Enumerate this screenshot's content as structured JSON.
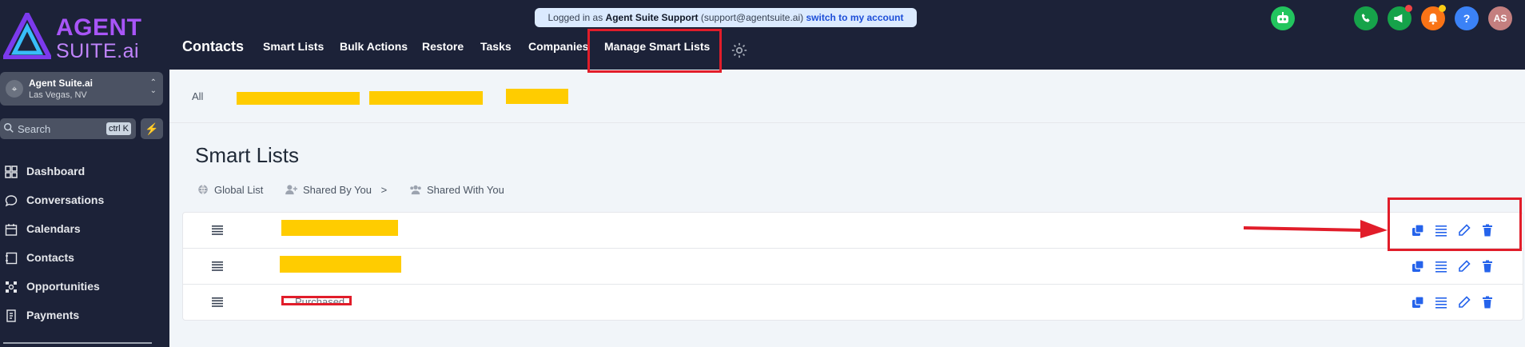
{
  "brand": {
    "line1": "AGENT",
    "line2": "SUITE.ai"
  },
  "login_banner": {
    "prefix": "Logged in as",
    "user": "Agent Suite Support",
    "email": "(support@agentsuite.ai)",
    "switch_label": "switch to my account"
  },
  "nav": {
    "title": "Contacts",
    "items": [
      "Smart Lists",
      "Bulk Actions",
      "Restore",
      "Tasks",
      "Companies",
      "Manage Smart Lists"
    ],
    "active": "Manage Smart Lists"
  },
  "top_icons": [
    {
      "name": "bot-icon",
      "color": "#22c55e"
    },
    {
      "name": "phone-icon",
      "color": "#16a34a"
    },
    {
      "name": "megaphone-icon",
      "color": "#16a34a"
    },
    {
      "name": "bell-icon",
      "color": "#f97316"
    },
    {
      "name": "help-icon",
      "color": "#3b82f6",
      "glyph": "?"
    },
    {
      "name": "user-avatar",
      "color": "#c47f7f",
      "glyph": "AS"
    }
  ],
  "sidebar": {
    "account": {
      "name": "Agent Suite.ai",
      "location": "Las Vegas, NV"
    },
    "search": {
      "placeholder": "Search",
      "shortcut": "ctrl K"
    },
    "items": [
      {
        "label": "Dashboard",
        "icon": "dashboard-icon"
      },
      {
        "label": "Conversations",
        "icon": "chat-icon"
      },
      {
        "label": "Calendars",
        "icon": "calendar-icon"
      },
      {
        "label": "Contacts",
        "icon": "contacts-icon"
      },
      {
        "label": "Opportunities",
        "icon": "opportunities-icon"
      },
      {
        "label": "Payments",
        "icon": "payments-icon"
      }
    ]
  },
  "main": {
    "filter_tabs": {
      "all_label": "All"
    },
    "title": "Smart Lists",
    "sub_tabs": [
      {
        "label": "Global List",
        "icon": "globe-icon"
      },
      {
        "label": "Shared By You",
        "icon": "user-plus-icon",
        "suffix": ">"
      },
      {
        "label": "Shared With You",
        "icon": "users-icon"
      }
    ],
    "rows": [
      {
        "name": "",
        "redacted": true
      },
      {
        "name": "",
        "redacted": true
      },
      {
        "name": "Purchased",
        "redacted": false
      }
    ],
    "row_actions": [
      "duplicate-icon",
      "list-icon",
      "edit-icon",
      "delete-icon"
    ]
  },
  "colors": {
    "topbar": "#1c2238",
    "accent": "#2563eb",
    "annotation": "#e11d2a",
    "redaction": "#ffcc00"
  }
}
